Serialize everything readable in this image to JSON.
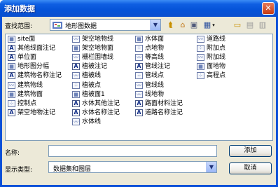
{
  "window": {
    "title": "添加数据",
    "close_glyph": "✕"
  },
  "toolbar": {
    "look_in_label": "查找范围:",
    "look_in_value": "地形图数据",
    "icons": [
      "up-folder-icon",
      "home-icon",
      "connect-folder-icon",
      "view-menu-icon",
      "new-folder-icon",
      "catalog-icon",
      "properties-icon"
    ]
  },
  "files": {
    "col1": [
      {
        "icon": "polygon-layer",
        "label": "site面"
      },
      {
        "icon": "annotation-layer",
        "label": "其他线面注记"
      },
      {
        "icon": "annotation-layer",
        "label": "单位面"
      },
      {
        "icon": "polygon-layer",
        "label": "地形图分幅"
      },
      {
        "icon": "annotation-layer",
        "label": "建筑物名称注记"
      },
      {
        "icon": "polyline-layer",
        "label": "建筑物线"
      },
      {
        "icon": "polygon-layer",
        "label": "建筑物面"
      },
      {
        "icon": "point-layer",
        "label": "控制点"
      },
      {
        "icon": "annotation-layer",
        "label": "架空地物注记"
      }
    ],
    "col2": [
      {
        "icon": "polyline-layer",
        "label": "架空地物线"
      },
      {
        "icon": "polygon-layer",
        "label": "架空地物面"
      },
      {
        "icon": "polyline-layer",
        "label": "栅栏围墙线"
      },
      {
        "icon": "annotation-layer",
        "label": "植被注记"
      },
      {
        "icon": "polyline-layer",
        "label": "植被线"
      },
      {
        "icon": "point-layer",
        "label": "植被点"
      },
      {
        "icon": "polygon-layer",
        "label": "植被面1"
      },
      {
        "icon": "annotation-layer",
        "label": "水体其他注记"
      },
      {
        "icon": "annotation-layer",
        "label": "水体名称注记"
      },
      {
        "icon": "polyline-layer",
        "label": "水体线"
      }
    ],
    "col3": [
      {
        "icon": "polygon-layer",
        "label": "水体面"
      },
      {
        "icon": "point-layer",
        "label": "点地物"
      },
      {
        "icon": "polyline-layer",
        "label": "等高线"
      },
      {
        "icon": "annotation-layer",
        "label": "管线注记"
      },
      {
        "icon": "point-layer",
        "label": "管线点"
      },
      {
        "icon": "polyline-layer",
        "label": "管线线"
      },
      {
        "icon": "polyline-layer",
        "label": "线地物"
      },
      {
        "icon": "annotation-layer",
        "label": "路面材料注记"
      },
      {
        "icon": "annotation-layer",
        "label": "道路名称注记"
      }
    ],
    "col4": [
      {
        "icon": "polyline-layer",
        "label": "道路线"
      },
      {
        "icon": "point-layer",
        "label": "附加点"
      },
      {
        "icon": "polyline-layer",
        "label": "附加线"
      },
      {
        "icon": "polygon-layer",
        "label": "面地物"
      },
      {
        "icon": "point-layer",
        "label": "高程点"
      }
    ]
  },
  "footer": {
    "name_label": "名称:",
    "name_value": "",
    "type_label": "显示类型:",
    "type_value": "数据集和图层",
    "add_label": "添加",
    "cancel_label": "取消"
  }
}
